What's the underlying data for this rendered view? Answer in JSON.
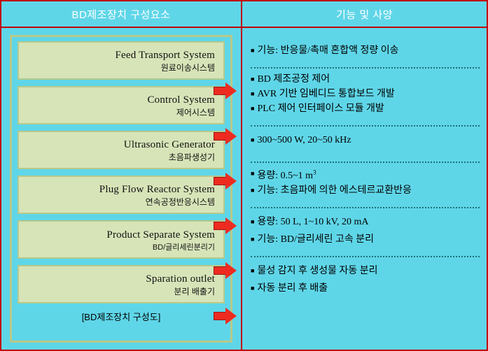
{
  "header": {
    "left_title": "BD제조장치 구성요소",
    "right_title": "기능 및 사양"
  },
  "colors": {
    "background": "#5fd6e8",
    "border": "#c00000",
    "box_fill": "#d7e4b8",
    "box_border": "#b7c98b",
    "arrow": "#ee2b20",
    "divider": "#1b6f77",
    "header_text": "#ffffff"
  },
  "components": [
    {
      "en": "Feed Transport  System",
      "ko": "원료이송시스템",
      "small": false
    },
    {
      "en": "Control System",
      "ko": "제어시스템",
      "small": false
    },
    {
      "en": "Ultrasonic Generator",
      "ko": "초음파생성기",
      "small": false
    },
    {
      "en": "Plug Flow Reactor System",
      "ko": "연속공정반응시스템",
      "small": false
    },
    {
      "en": "Product Separate System",
      "ko": "BD/글리세린분리기",
      "small": true
    },
    {
      "en": "Sparation outlet",
      "ko": "분리 배출기",
      "small": false
    }
  ],
  "panel_caption": "[BD제조장치  구성도]",
  "specs": [
    {
      "lines": [
        "기능: 반응물/촉매 혼합액 정량 이송"
      ]
    },
    {
      "lines": [
        "BD 제조공정 제어",
        "AVR 기반 임베디드 통합보드 개발",
        "PLC 제어 인터페이스 모듈 개발"
      ]
    },
    {
      "lines": [
        "300~500 W,  20~50 kHz"
      ]
    },
    {
      "lines": [
        "용량: 0.5~1 m3",
        "기능: 초음파에  의한  에스테르교환반응"
      ]
    },
    {
      "lines": [
        "용량: 50 L, 1~10 kV, 20 mA",
        "기능: BD/글리세린 고속 분리"
      ]
    },
    {
      "lines": [
        "물성 감지 후 생성물 자동 분리",
        "자동 분리 후 배출"
      ]
    }
  ],
  "icons": {
    "arrow": "right-arrow-icon",
    "bullet": "square-bullet-icon"
  }
}
